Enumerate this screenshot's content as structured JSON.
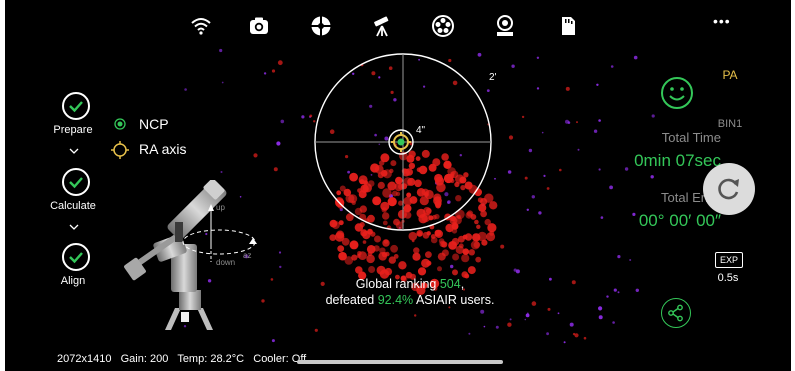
{
  "toolbar": {
    "icons": [
      "wifi-icon",
      "camera-icon",
      "focuser-icon",
      "telescope-icon",
      "filter-wheel-icon",
      "polar-align-icon",
      "storage-icon"
    ],
    "more": "•••"
  },
  "steps": [
    {
      "label": "Prepare"
    },
    {
      "label": "Calculate"
    },
    {
      "label": "Align"
    }
  ],
  "legend": {
    "ncp": "NCP",
    "ra_axis": "RA axis",
    "ncp_color": "#34c759",
    "ra_color": "#e6c04a"
  },
  "target": {
    "outer_label": "2'",
    "inner_label": "4\""
  },
  "mount_diagram": {
    "up_label": "up",
    "down_label": "down",
    "az_label": "az"
  },
  "ranking": {
    "line1_prefix": "Global ranking ",
    "rank": "504",
    "line1_suffix": ",",
    "line2_prefix": "defeated ",
    "percent": "92.4%",
    "line2_suffix": " ASIAIR users."
  },
  "right_panel": {
    "mode": "PA",
    "bin": "BIN1",
    "total_time_label": "Total Time",
    "total_time_value": "0min 07sec",
    "total_error_label": "Total Error",
    "total_error_value": "00° 00′ 00″",
    "exp_label": "EXP",
    "exp_value": "0.5s"
  },
  "status_bar": {
    "resolution": "2072x1410",
    "gain": "Gain: 200",
    "temp": "Temp: 28.2°C",
    "cooler": "Cooler: Off"
  },
  "colors": {
    "accent_green": "#34c759",
    "star_red": "#e8201c",
    "star_purple": "#8a2be2",
    "pa_yellow": "#e6c04a"
  }
}
